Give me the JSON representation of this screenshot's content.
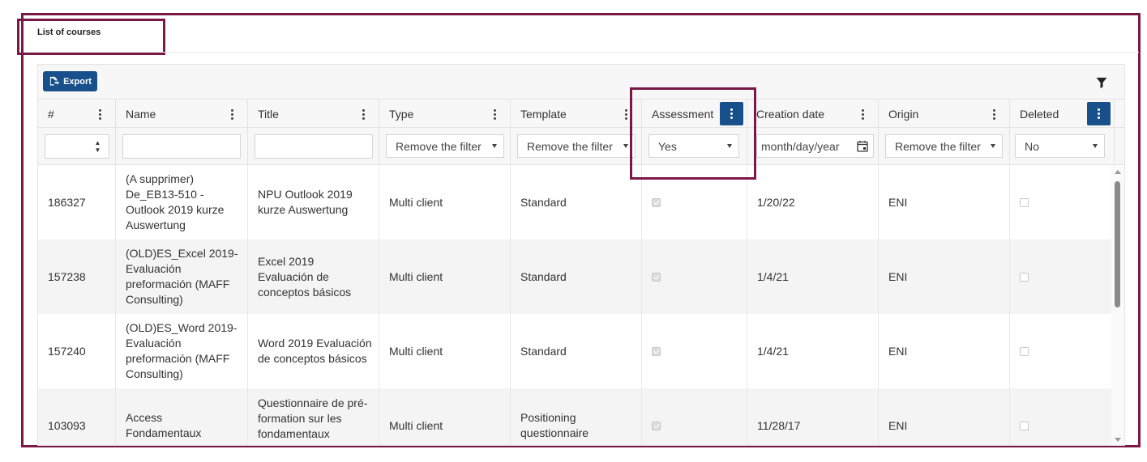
{
  "page": {
    "title": "List of courses"
  },
  "toolbar": {
    "export_label": "Export",
    "filter_icon": "funnel-icon"
  },
  "columns": [
    {
      "key": "id",
      "label": "#"
    },
    {
      "key": "name",
      "label": "Name"
    },
    {
      "key": "title",
      "label": "Title"
    },
    {
      "key": "type",
      "label": "Type"
    },
    {
      "key": "template",
      "label": "Template"
    },
    {
      "key": "assessment",
      "label": "Assessment"
    },
    {
      "key": "creation_date",
      "label": "Creation date"
    },
    {
      "key": "origin",
      "label": "Origin"
    },
    {
      "key": "deleted",
      "label": "Deleted"
    }
  ],
  "filters": {
    "type": "Remove the filter",
    "template": "Remove the filter",
    "assessment": "Yes",
    "creation_date_placeholder": "month/day/year",
    "origin": "Remove the filter",
    "deleted": "No"
  },
  "rows": [
    {
      "id": "186327",
      "name": "(A supprimer) De_EB13-510 - Outlook 2019 kurze Auswertung",
      "title": "NPU Outlook 2019 kurze Auswertung",
      "type": "Multi client",
      "template": "Standard",
      "assessment": true,
      "creation_date": "1/20/22",
      "origin": "ENI",
      "deleted": false
    },
    {
      "id": "157238",
      "name": "(OLD)ES_Excel 2019- Evaluación preformación (MAFF Consulting)",
      "title": "Excel 2019 Evaluación de conceptos básicos",
      "type": "Multi client",
      "template": "Standard",
      "assessment": true,
      "creation_date": "1/4/21",
      "origin": "ENI",
      "deleted": false
    },
    {
      "id": "157240",
      "name": "(OLD)ES_Word 2019- Evaluación preformación (MAFF Consulting)",
      "title": "Word 2019 Evaluación de conceptos básicos",
      "type": "Multi client",
      "template": "Standard",
      "assessment": true,
      "creation_date": "1/4/21",
      "origin": "ENI",
      "deleted": false
    },
    {
      "id": "103093",
      "name": "Access Fondamentaux",
      "title": "Questionnaire de pré-formation sur les fondamentaux d'Access",
      "type": "Multi client",
      "template": "Positioning questionnaire",
      "assessment": true,
      "creation_date": "11/28/17",
      "origin": "ENI",
      "deleted": false
    }
  ],
  "colors": {
    "accent": "#17508b",
    "annotation": "#7a1848",
    "alt_row": "#f4f4f4"
  }
}
